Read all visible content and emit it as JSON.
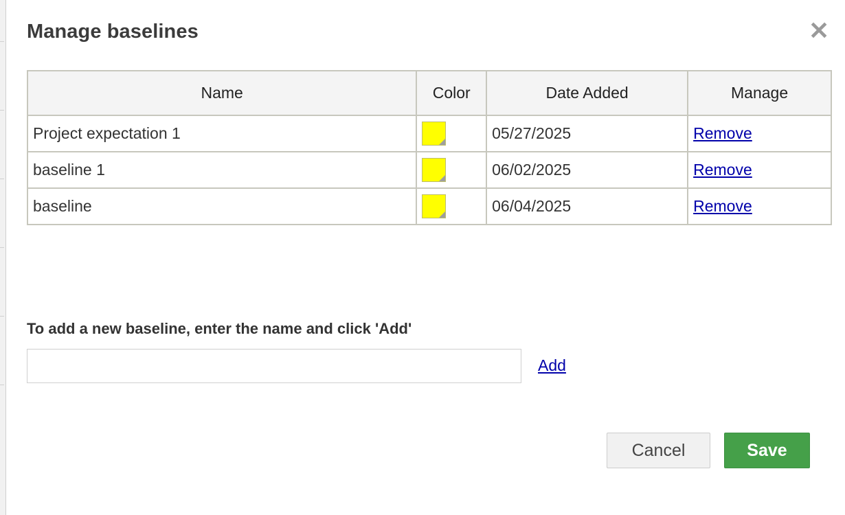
{
  "dialog": {
    "title": "Manage baselines",
    "close_icon": "close-icon"
  },
  "table": {
    "headers": [
      "Name",
      "Color",
      "Date Added",
      "Manage"
    ],
    "rows": [
      {
        "name": "Project expectation 1",
        "color": "#ffff00",
        "date": "05/27/2025",
        "action": "Remove"
      },
      {
        "name": "baseline 1",
        "color": "#ffff00",
        "date": "06/02/2025",
        "action": "Remove"
      },
      {
        "name": "baseline",
        "color": "#ffff00",
        "date": "06/04/2025",
        "action": "Remove"
      }
    ]
  },
  "add_section": {
    "label": "To add a new baseline, enter the name and click 'Add'",
    "input_value": "",
    "input_placeholder": "",
    "add_label": "Add"
  },
  "buttons": {
    "cancel_label": "Cancel",
    "save_label": "Save"
  },
  "colors": {
    "save_button": "#45a049",
    "link": "#0000aa",
    "swatch": "#ffff00"
  }
}
